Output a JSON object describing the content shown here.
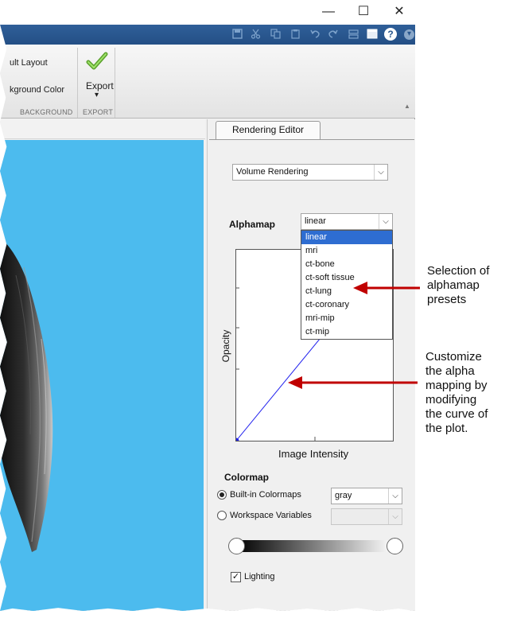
{
  "window_controls": {
    "minimize": "—",
    "maximize": "☐",
    "close": "✕"
  },
  "quick_access": {
    "icons": [
      "save-icon",
      "cut-icon",
      "copy-icon",
      "paste-icon",
      "undo-icon",
      "redo-icon",
      "tile-icon",
      "window-icon",
      "help-icon",
      "dropdown-icon"
    ],
    "help_glyph": "?",
    "dropdown_glyph": "▾"
  },
  "ribbon": {
    "layout_label": "ult Layout",
    "bg_color_label": "kground Color",
    "background_section": "BACKGROUND",
    "export_label": "Export",
    "export_arrow": "▾",
    "export_section": "EXPORT",
    "collapse_glyph": "▲"
  },
  "editor": {
    "tab_label": "Rendering Editor",
    "rendering_mode": "Volume Rendering",
    "alphamap_label": "Alphamap",
    "alphamap_value": "linear",
    "alphamap_options": [
      "linear",
      "mri",
      "ct-bone",
      "ct-soft tissue",
      "ct-lung",
      "ct-coronary",
      "mri-mip",
      "ct-mip"
    ],
    "alphamap_selected_index": 0,
    "y_axis_label": "Opacity",
    "x_axis_label": "Image Intensity",
    "colormap_label": "Colormap",
    "builtin_label": "Built-in Colormaps",
    "builtin_selected": true,
    "builtin_value": "gray",
    "workspace_label": "Workspace Variables",
    "workspace_value": "",
    "lighting_label": "Lighting",
    "lighting_checked": true
  },
  "annotations": {
    "presets_lines": [
      "Selection of",
      "alphamap",
      "presets"
    ],
    "curve_lines": [
      "Customize",
      "the alpha",
      "mapping by",
      "modifying",
      "the curve of",
      "the plot."
    ]
  },
  "colors": {
    "viewport_bg": "#4cbbee",
    "arrow_red": "#c00000",
    "curve_blue": "#2222ee",
    "selection_blue": "#2e6dd1",
    "toolbar_blue": "#2a5890"
  }
}
